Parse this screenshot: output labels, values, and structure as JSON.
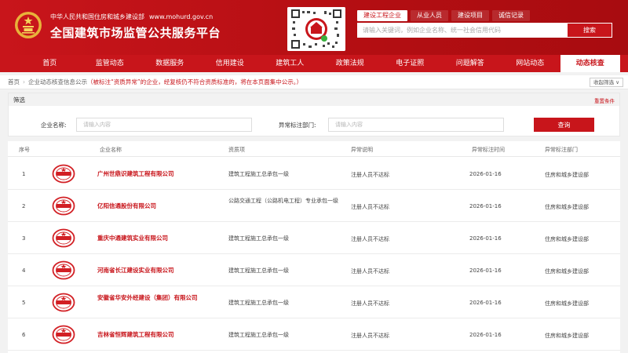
{
  "header": {
    "subtitle": "中华人民共和国住房和城乡建设部",
    "url": "www.mohurd.gov.cn",
    "title": "全国建筑市场监管公共服务平台",
    "search_tabs": [
      "建设工程企业",
      "从业人员",
      "建设项目",
      "诚信记录"
    ],
    "search_placeholder": "请输入关键词，例如企业名称、统一社会信用代码",
    "search_button": "搜索"
  },
  "nav": {
    "items": [
      "首页",
      "监管动态",
      "数据服务",
      "信用建设",
      "建筑工人",
      "政策法规",
      "电子证照",
      "问题解答",
      "网站动态",
      "动态核查"
    ],
    "active_index": 9
  },
  "breadcrumb": {
    "home": "首页",
    "page": "企业动态核查信息公示",
    "note": "（被标注“资质异常”的企业，经复核仍不符合资质标准的，将在本页面集中公示。）",
    "collapse": "收起筛选 ∨"
  },
  "filter": {
    "title": "筛选",
    "reset": "重置条件",
    "company_label": "企业名称:",
    "company_placeholder": "请输入内容",
    "dept_label": "异常标注部门:",
    "dept_placeholder": "请输入内容",
    "query_button": "查询"
  },
  "table": {
    "headers": [
      "序号",
      "企业名称",
      "资质项",
      "异常说明",
      "异常标注时间",
      "异常标注部门"
    ],
    "rows": [
      {
        "no": "1",
        "name": "广州世鼎识建筑工程有限公司",
        "qual": "建筑工程施工总承包一级",
        "reason": "注册人员不达标",
        "date": "2026-01-16",
        "dept": "住房和城乡建设部"
      },
      {
        "no": "2",
        "name": "亿阳信通股份有限公司",
        "qual": "公路交通工程（公路机电工程）专业承包一级",
        "reason": "注册人员不达标",
        "date": "2026-01-16",
        "dept": "住房和城乡建设部"
      },
      {
        "no": "3",
        "name": "重庆中通建筑实业有限公司",
        "qual": "建筑工程施工总承包一级",
        "reason": "注册人员不达标",
        "date": "2026-01-16",
        "dept": "住房和城乡建设部"
      },
      {
        "no": "4",
        "name": "河南省长江建设实业有限公司",
        "qual": "建筑工程施工总承包一级",
        "reason": "注册人员不达标",
        "date": "2026-01-16",
        "dept": "住房和城乡建设部"
      },
      {
        "no": "5",
        "name": "安徽省华安外经建设（集团）有限公司",
        "qual": "建筑工程施工总承包一级",
        "reason": "注册人员不达标",
        "date": "2026-01-16",
        "dept": "住房和城乡建设部"
      },
      {
        "no": "6",
        "name": "吉林省恒辉建筑工程有限公司",
        "qual": "建筑工程施工总承包一级",
        "reason": "注册人员不达标",
        "date": "2026-01-16",
        "dept": "住房和城乡建设部"
      }
    ]
  },
  "colors": {
    "brand_red": "#c8151b"
  }
}
